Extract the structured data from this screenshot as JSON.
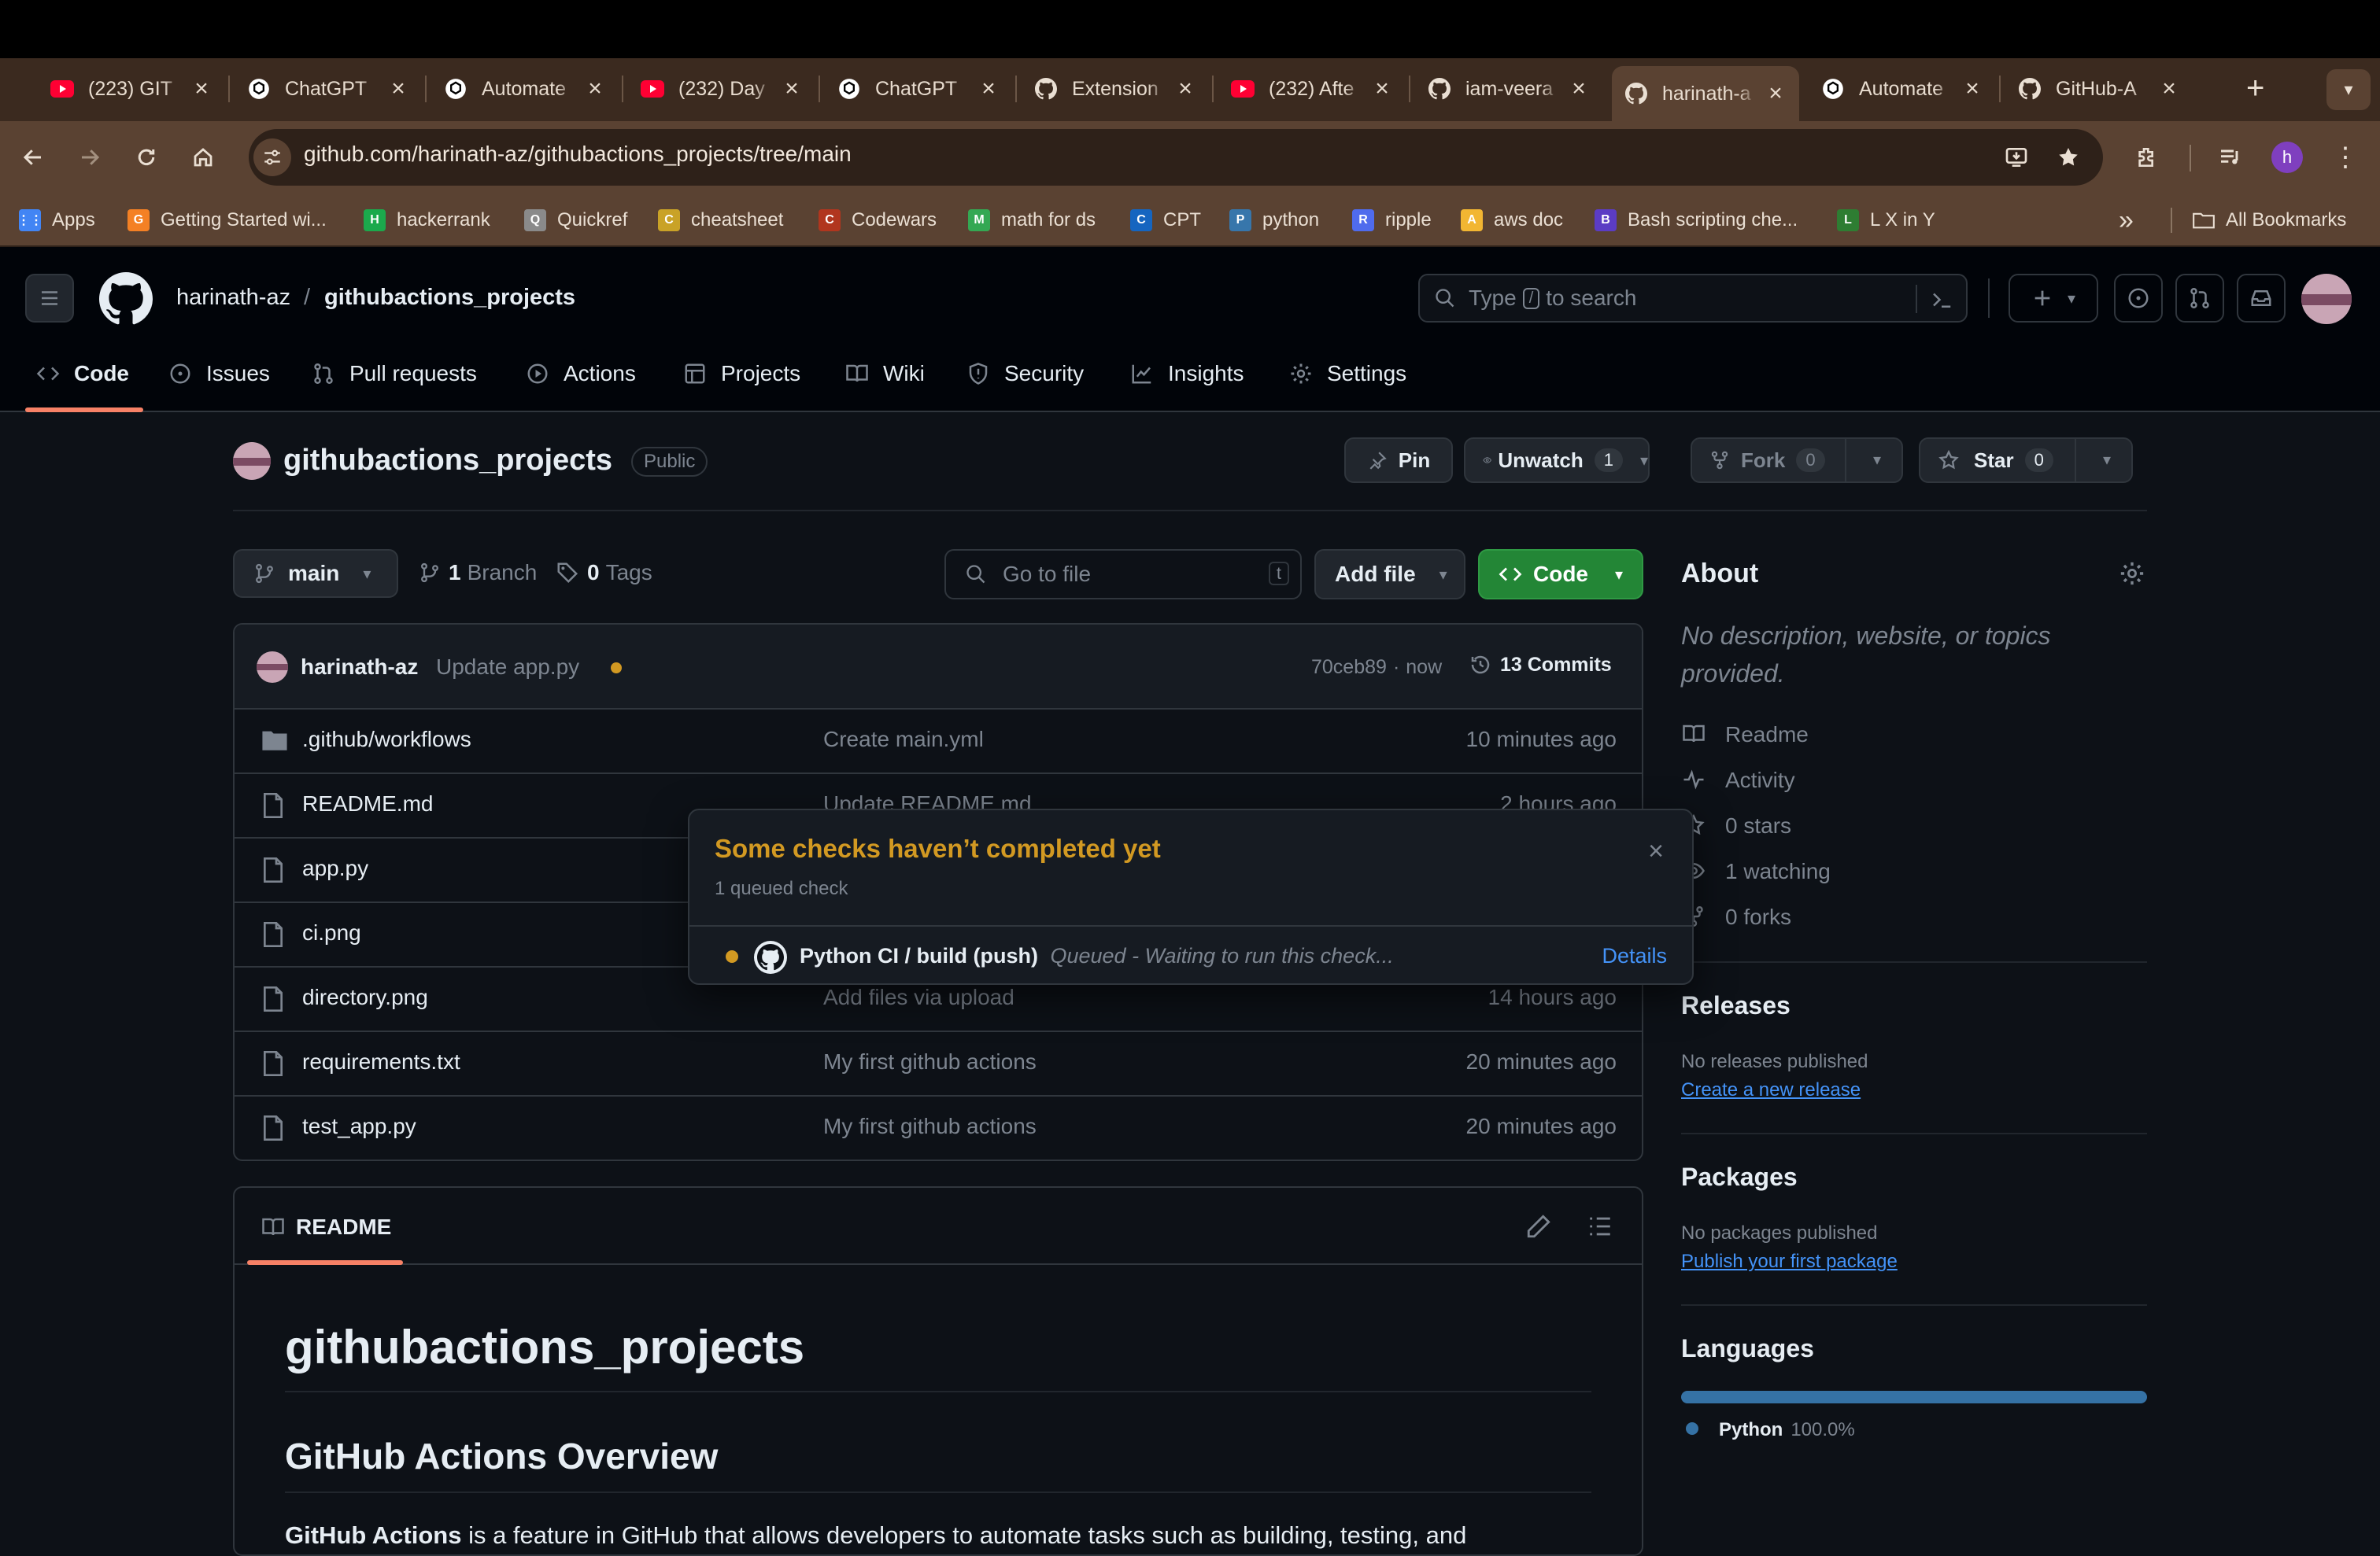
{
  "browser": {
    "tabs": [
      {
        "title": "(223) GIT",
        "icon": "youtube-icon"
      },
      {
        "title": "ChatGPT",
        "icon": "openai-icon"
      },
      {
        "title": "Automate",
        "icon": "openai-icon"
      },
      {
        "title": "(232) Day",
        "icon": "youtube-icon"
      },
      {
        "title": "ChatGPT",
        "icon": "openai-icon"
      },
      {
        "title": "Extension",
        "icon": "github-icon"
      },
      {
        "title": "(232) Afte",
        "icon": "youtube-icon"
      },
      {
        "title": "iam-veera",
        "icon": "github-icon"
      },
      {
        "title": "harinath-a",
        "icon": "github-icon"
      },
      {
        "title": "Automate",
        "icon": "openai-icon"
      },
      {
        "title": "GitHub-A",
        "icon": "github-icon"
      }
    ],
    "url": "github.com/harinath-az/githubactions_projects/tree/main",
    "profile_initial": "h",
    "bookmarks": [
      {
        "label": "Apps",
        "color": "#4285f4"
      },
      {
        "label": "Getting Started wi...",
        "color": "#f48024"
      },
      {
        "label": "hackerrank",
        "color": "#1ba94c"
      },
      {
        "label": "Quickref",
        "color": "#8a8a8a"
      },
      {
        "label": "cheatsheet",
        "color": "#c9a227"
      },
      {
        "label": "Codewars",
        "color": "#b1361e"
      },
      {
        "label": "math for ds",
        "color": "#34a853"
      },
      {
        "label": "CPT",
        "color": "#1565c0"
      },
      {
        "label": "python",
        "color": "#3776ab"
      },
      {
        "label": "ripple",
        "color": "#4f6bed"
      },
      {
        "label": "aws doc",
        "color": "#f2b632"
      },
      {
        "label": "Bash scripting che...",
        "color": "#5b3cc4"
      },
      {
        "label": "L X in Y",
        "color": "#2e7d32"
      }
    ],
    "bookmarks_overflow": "»",
    "all_bookmarks": "All Bookmarks"
  },
  "github": {
    "owner": "harinath-az",
    "slash": "/",
    "repo": "githubactions_projects",
    "search_prefix": "Type",
    "search_key": "/",
    "search_suffix": "to search",
    "nav": [
      "Code",
      "Issues",
      "Pull requests",
      "Actions",
      "Projects",
      "Wiki",
      "Security",
      "Insights",
      "Settings"
    ],
    "visibility": "Public",
    "pin": "Pin",
    "unwatch": "Unwatch",
    "watch_count": "1",
    "fork": "Fork",
    "fork_count": "0",
    "star": "Star",
    "star_count": "0",
    "branch": "main",
    "branch_count": "1",
    "branch_label": "Branch",
    "tag_count": "0",
    "tag_label": "Tags",
    "goto_placeholder": "Go to file",
    "goto_key": "t",
    "add_file": "Add file",
    "code_btn": "Code",
    "commit": {
      "author": "harinath-az",
      "message": "Update app.py",
      "hash": "70ceb89",
      "sep": "·",
      "when": "now",
      "commits": "13 Commits"
    },
    "files": [
      {
        "name": ".github/workflows",
        "type": "folder",
        "message": "Create main.yml",
        "time": "10 minutes ago"
      },
      {
        "name": "README.md",
        "type": "file",
        "message": "Update README.md",
        "time": "2 hours ago"
      },
      {
        "name": "app.py",
        "type": "file",
        "message": "",
        "time": ""
      },
      {
        "name": "ci.png",
        "type": "file",
        "message": "",
        "time": ""
      },
      {
        "name": "directory.png",
        "type": "file",
        "message": "Add files via upload",
        "time": "14 hours ago"
      },
      {
        "name": "requirements.txt",
        "type": "file",
        "message": "My first github actions",
        "time": "20 minutes ago"
      },
      {
        "name": "test_app.py",
        "type": "file",
        "message": "My first github actions",
        "time": "20 minutes ago"
      }
    ],
    "readme": {
      "tab": "README",
      "h1": "githubactions_projects",
      "h2": "GitHub Actions Overview",
      "p_bold": "GitHub Actions",
      "p_rest": " is a feature in GitHub that allows developers to automate tasks such as building, testing, and"
    },
    "about": {
      "title": "About",
      "description": "No description, website, or topics provided.",
      "readme": "Readme",
      "activity": "Activity",
      "stars": "0 stars",
      "watching": "1 watching",
      "forks": "0 forks"
    },
    "releases": {
      "title": "Releases",
      "none": "No releases published",
      "link": "Create a new release"
    },
    "packages": {
      "title": "Packages",
      "none": "No packages published",
      "link": "Publish your first package"
    },
    "languages": {
      "title": "Languages",
      "name": "Python",
      "percent": "100.0%",
      "fraction": 1.0,
      "color": "#3572A5"
    },
    "checks_popover": {
      "title": "Some checks haven’t completed yet",
      "subtitle": "1 queued check",
      "check_name": "Python CI / build (push)",
      "check_status": "Queued - Waiting to run this check...",
      "details": "Details"
    }
  },
  "colors": {
    "accent_green": "#238636",
    "pending": "#d29922",
    "link": "#4493f8",
    "active_underline": "#f78166"
  }
}
